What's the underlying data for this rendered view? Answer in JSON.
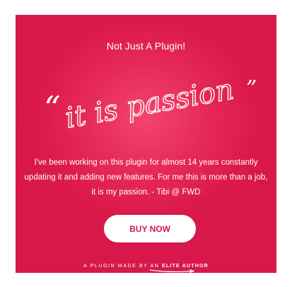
{
  "header": {
    "subtitle": "Not Just A Plugin!"
  },
  "hero": {
    "open_quote": "“",
    "script_text": "it is passion",
    "close_quote": "”"
  },
  "body": {
    "description": "I've been working on this plugin for almost 14 years constantly updating it and  adding new features. For me this is more than a job, it is my passion.  - Tibi @ FWD"
  },
  "cta": {
    "buy_label": "BUY NOW"
  },
  "footer": {
    "made_by_prefix": "A PLUGIN MADE BY AN ",
    "elite_label": "ELITE AUTHOR"
  },
  "colors": {
    "background": "#dc1a4a",
    "button_text": "#d8174a",
    "text": "#ffffff"
  },
  "icons": {
    "arrow": "curved-arrow-icon"
  }
}
